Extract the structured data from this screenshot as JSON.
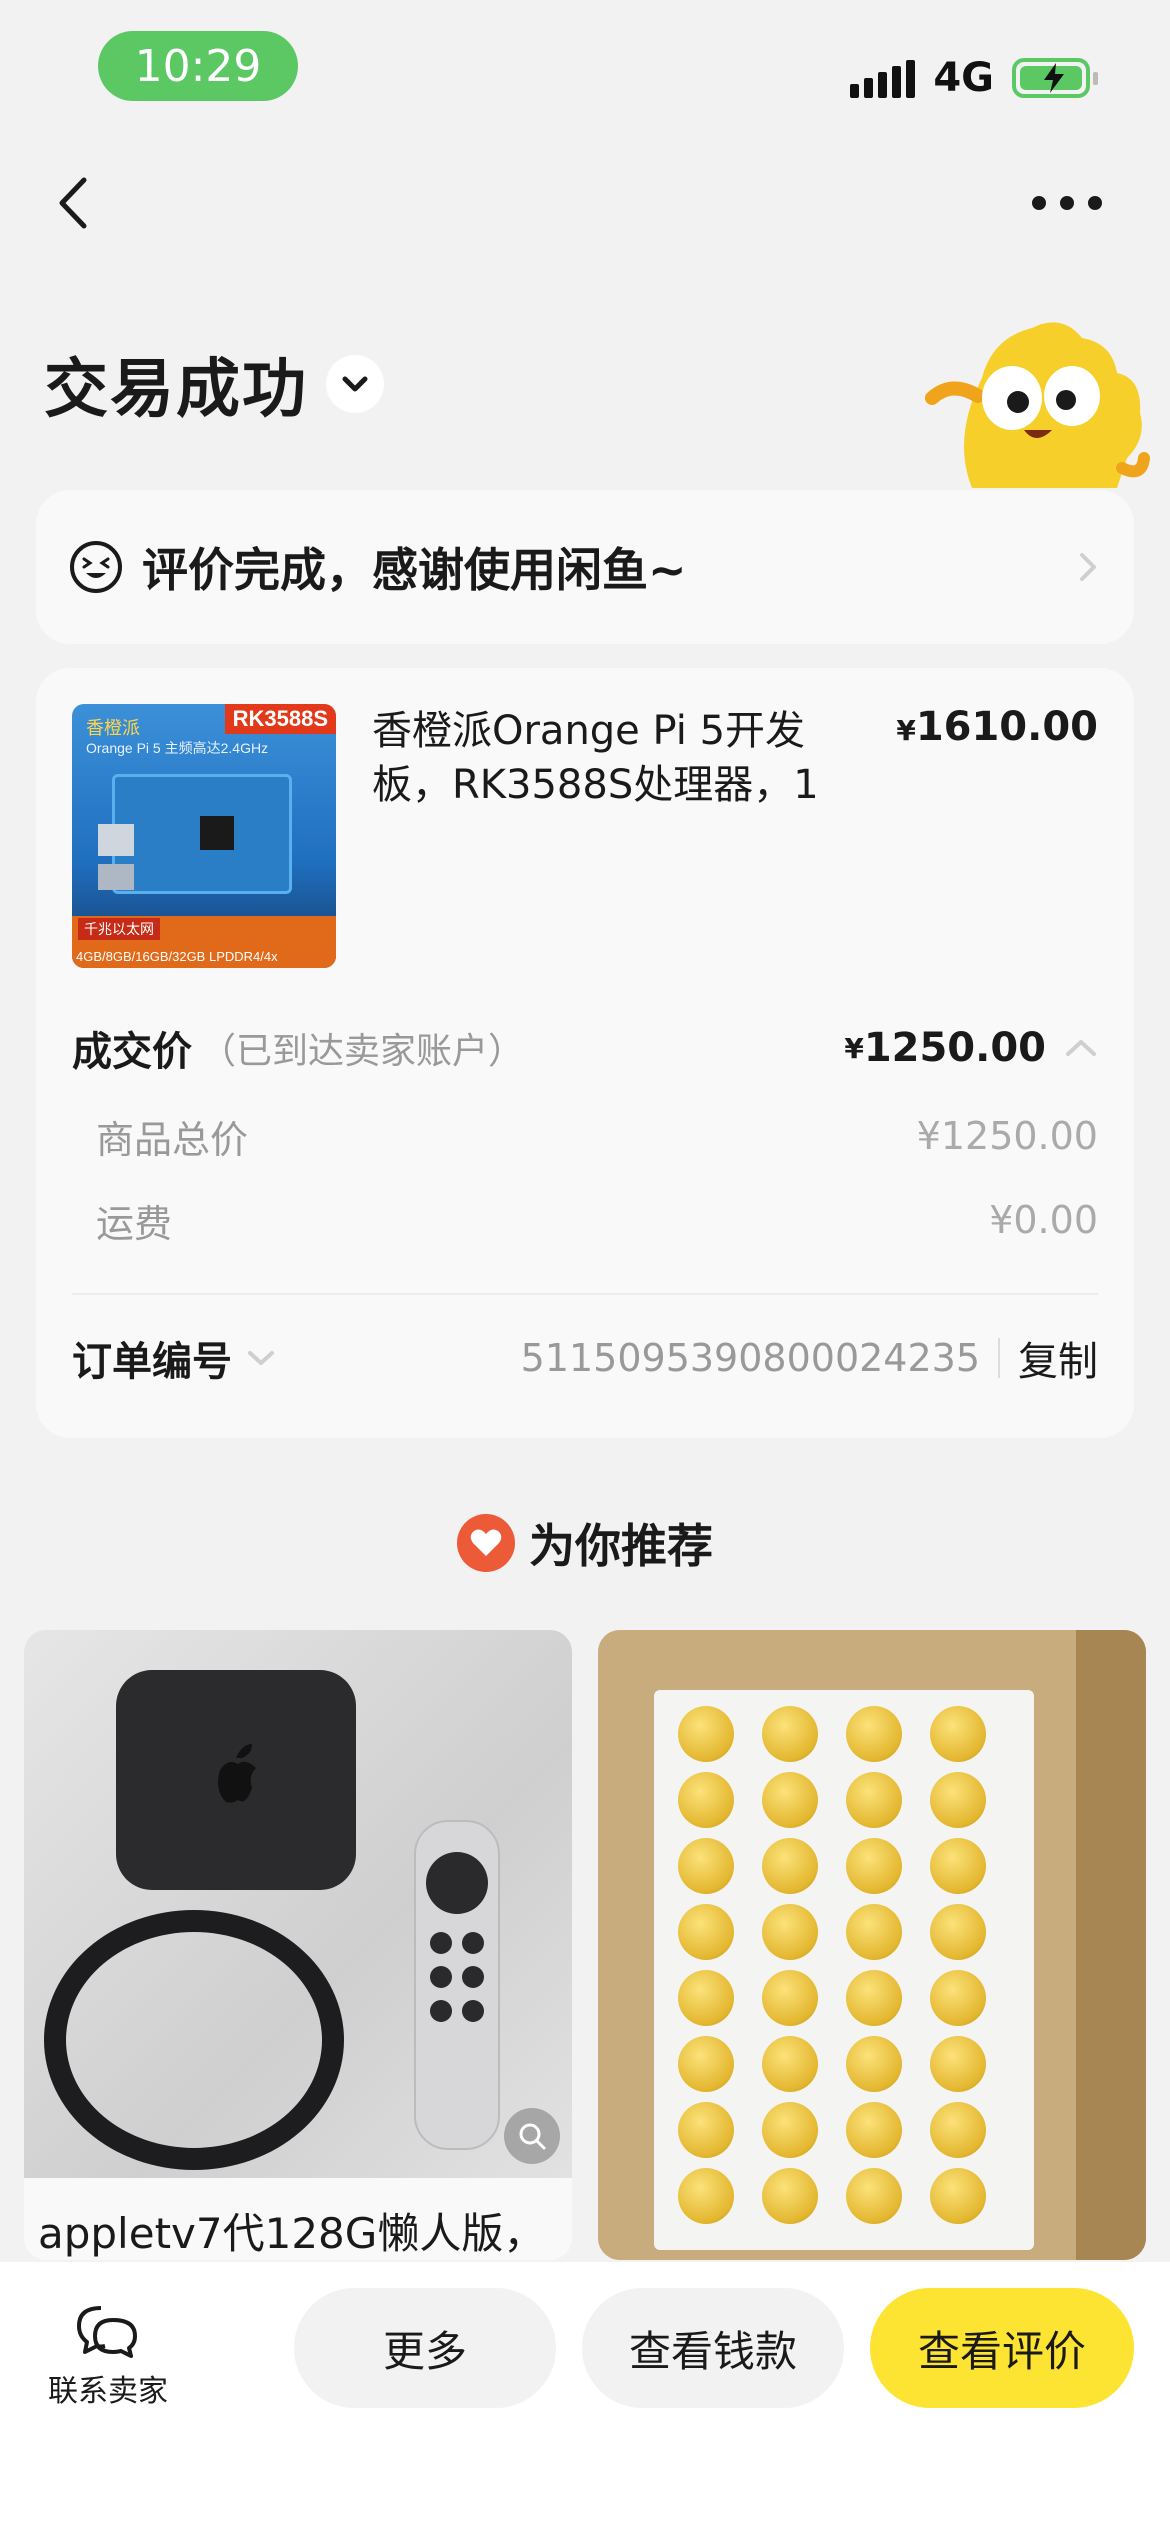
{
  "status_bar": {
    "time": "10:29",
    "network": "4G"
  },
  "header": {
    "title": "交易成功"
  },
  "review_banner": {
    "text": "评价完成，感谢使用闲鱼~"
  },
  "order": {
    "product_title": "香橙派Orange Pi 5开发板，RK3588S处理器，1",
    "product_price": "1610.00",
    "thumbnail": {
      "badge": "RK3588S",
      "brand": "香橙派",
      "model": "Orange Pi 5",
      "speed": "主频高达2.4GHz",
      "tag_ethernet": "千兆以太网",
      "memory": "4GB/8GB/16GB/32GB LPDDR4/4x"
    },
    "deal_label": "成交价",
    "deal_note": "（已到达卖家账户）",
    "deal_price": "1250.00",
    "currency_symbol": "¥",
    "breakdown": [
      {
        "label": "商品总价",
        "value": "¥1250.00"
      },
      {
        "label": "运费",
        "value": "¥0.00"
      }
    ],
    "order_no_label": "订单编号",
    "order_no": "5115095390800024235",
    "copy_label": "复制"
  },
  "recommend": {
    "title": "为你推荐",
    "items": [
      {
        "caption": "appletv7代128G懒人版，"
      },
      {
        "caption": ""
      }
    ]
  },
  "bottom_bar": {
    "contact_label": "联系卖家",
    "more_label": "更多",
    "money_label": "查看钱款",
    "review_label": "查看评价"
  },
  "colors": {
    "accent_yellow": "#fde332",
    "status_green": "#5cc864",
    "heart_red": "#ec5a37"
  },
  "icons": [
    "back-icon",
    "more-icon",
    "chevron-down-icon",
    "smile-icon",
    "chevron-right-icon",
    "chevron-up-icon",
    "heart-icon",
    "zoom-icon",
    "chat-icon"
  ]
}
